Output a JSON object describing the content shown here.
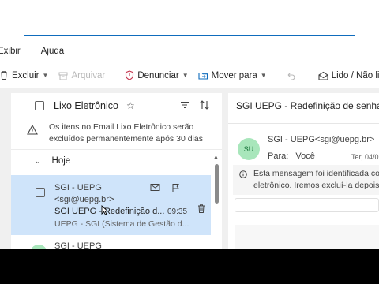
{
  "menu": [
    "Exibir",
    "Ajuda"
  ],
  "toolbar": {
    "delete_label": "Excluir",
    "archive_label": "Arquivar",
    "report_label": "Denunciar",
    "move_label": "Mover para",
    "read_unread_label": "Lido / Não lido"
  },
  "list": {
    "folder_title": "Lixo Eletrônico",
    "warning": "Os itens no Email Lixo Eletrônico serão excluídos permanentemente após 30 dias",
    "group_label": "Hoje",
    "items": [
      {
        "from_line1": "SGI - UEPG",
        "from_line2": "<sgi@uepg.br>",
        "subject": "SGI UEPG - Redefinição d...",
        "time": "09:35",
        "preview": "UEPG - SGI (Sistema de Gestão d..."
      }
    ],
    "next_from": "SGI - UEPG"
  },
  "reading": {
    "subject": "SGI UEPG - Redefinição de senha",
    "avatar_initials": "SU",
    "from": "SGI - UEPG<sgi@uepg.br>",
    "to_label": "Para:",
    "to_value": "Você",
    "date": "Ter, 04/0",
    "info_line1": "Esta mensagem foi identificada co",
    "info_line2": "eletrônico. Iremos excluí-la depois"
  },
  "colors": {
    "accent": "#0f6cbd",
    "selected_row": "#cfe4fa",
    "avatar_bg": "#a8e6bb",
    "avatar_fg": "#0b6a2f"
  }
}
